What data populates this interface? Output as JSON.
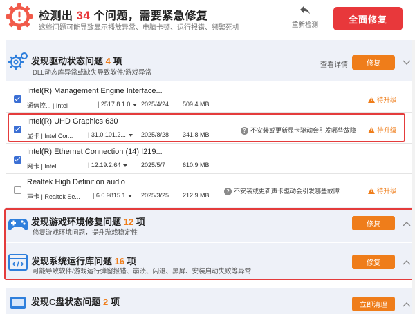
{
  "header": {
    "title_prefix": "检测出",
    "issue_count": "34",
    "title_suffix": "个问题，需要紧急修复",
    "subtitle": "这些问题可能导致显示播放异常、电脑卡顿、运行报错、频繁死机",
    "rescan_label": "重新检测",
    "fix_all_label": "全面修复"
  },
  "driver_section": {
    "title": "发现驱动状态问题",
    "count": "4",
    "unit": "项",
    "description": "DLL动态库异常或缺失导致软件/游戏异常",
    "detail_link": "查看详情",
    "fix_label": "修复"
  },
  "drivers": [
    {
      "name": "Intel(R) Management Engine Interface...",
      "category": "通信控...",
      "vendor": "| Intel",
      "version": "| 2517.8.1.0",
      "date": "2025/4/24",
      "size": "509.4 MB",
      "note": "",
      "status": "待升级",
      "checked": true
    },
    {
      "name": "Intel(R) UHD Graphics 630",
      "category": "显卡",
      "vendor": "| Intel Cor...",
      "version": "| 31.0.101.2...",
      "date": "2025/8/28",
      "size": "341.8 MB",
      "note": "不安装或更新显卡驱动会引发哪些故障",
      "status": "待升级",
      "checked": true
    },
    {
      "name": "Intel(R) Ethernet Connection (14) I219...",
      "category": "网卡",
      "vendor": "| Intel",
      "version": "| 12.19.2.64",
      "date": "2025/5/7",
      "size": "610.9 MB",
      "note": "",
      "status": "",
      "checked": true
    },
    {
      "name": "Realtek High Definition audio",
      "category": "声卡",
      "vendor": "| Realtek Se...",
      "version": "| 6.0.9815.1",
      "date": "2025/3/25",
      "size": "212.9 MB",
      "note": "不安装或更新声卡驱动会引发哪些故障",
      "status": "待升级",
      "checked": false
    }
  ],
  "game_section": {
    "title": "发现游戏环境修复问题",
    "count": "12",
    "unit": "项",
    "description": "修复游戏环境问题，提升游戏稳定性",
    "fix_label": "修复"
  },
  "runtime_section": {
    "title": "发现系统运行库问题",
    "count": "16",
    "unit": "项",
    "description": "可能导致软件/游戏运行弹窗报错、崩溃、闪退、黑屏、安装启动失败等异常",
    "fix_label": "修复"
  },
  "disk_section": {
    "title": "发现C盘状态问题",
    "count": "2",
    "unit": "项",
    "button_label": "立即清理"
  },
  "colors": {
    "accent_red": "#e8383b",
    "accent_orange": "#ef7d1a",
    "checkbox_blue": "#3b6fd4",
    "section_bg": "#eef1f8"
  }
}
